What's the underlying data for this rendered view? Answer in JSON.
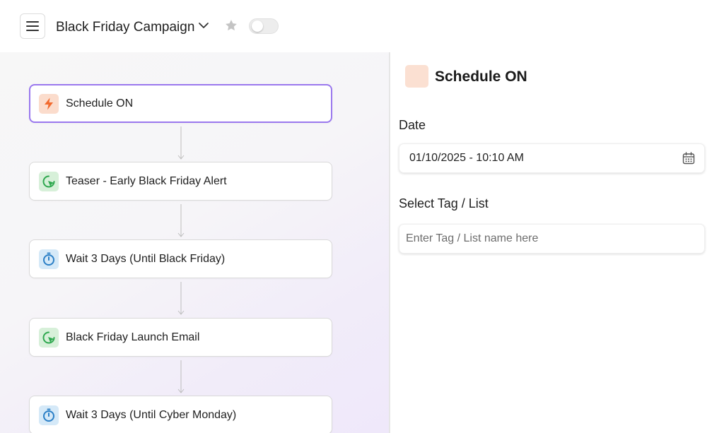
{
  "header": {
    "campaign_title": "Black Friday Campaign",
    "campaign_active": false
  },
  "workflow": {
    "nodes": [
      {
        "label": "Schedule ON",
        "icon": "lightning-icon",
        "type": "trigger",
        "selected": true
      },
      {
        "label": "Teaser - Early Black Friday Alert",
        "icon": "email-click-icon",
        "type": "email"
      },
      {
        "label": "Wait 3 Days (Until Black Friday)",
        "icon": "timer-icon",
        "type": "wait"
      },
      {
        "label": "Black Friday Launch Email",
        "icon": "email-click-icon",
        "type": "email"
      },
      {
        "label": "Wait 3 Days (Until Cyber Monday)",
        "icon": "timer-icon",
        "type": "wait"
      }
    ]
  },
  "panel": {
    "title": "Schedule ON",
    "date_label": "Date",
    "date_value": "01/10/2025 - 10:10 AM",
    "tag_label": "Select Tag / List",
    "tag_placeholder": "Enter Tag / List name here"
  },
  "colors": {
    "accent_selected": "#9a78ee",
    "trigger_icon_bg": "#fbdccc",
    "trigger_icon": "#f26a2e",
    "email_icon_bg": "#d7f0d9",
    "email_icon": "#2fa84f",
    "wait_icon_bg": "#d5e9f8",
    "wait_icon": "#2b7fc6"
  }
}
